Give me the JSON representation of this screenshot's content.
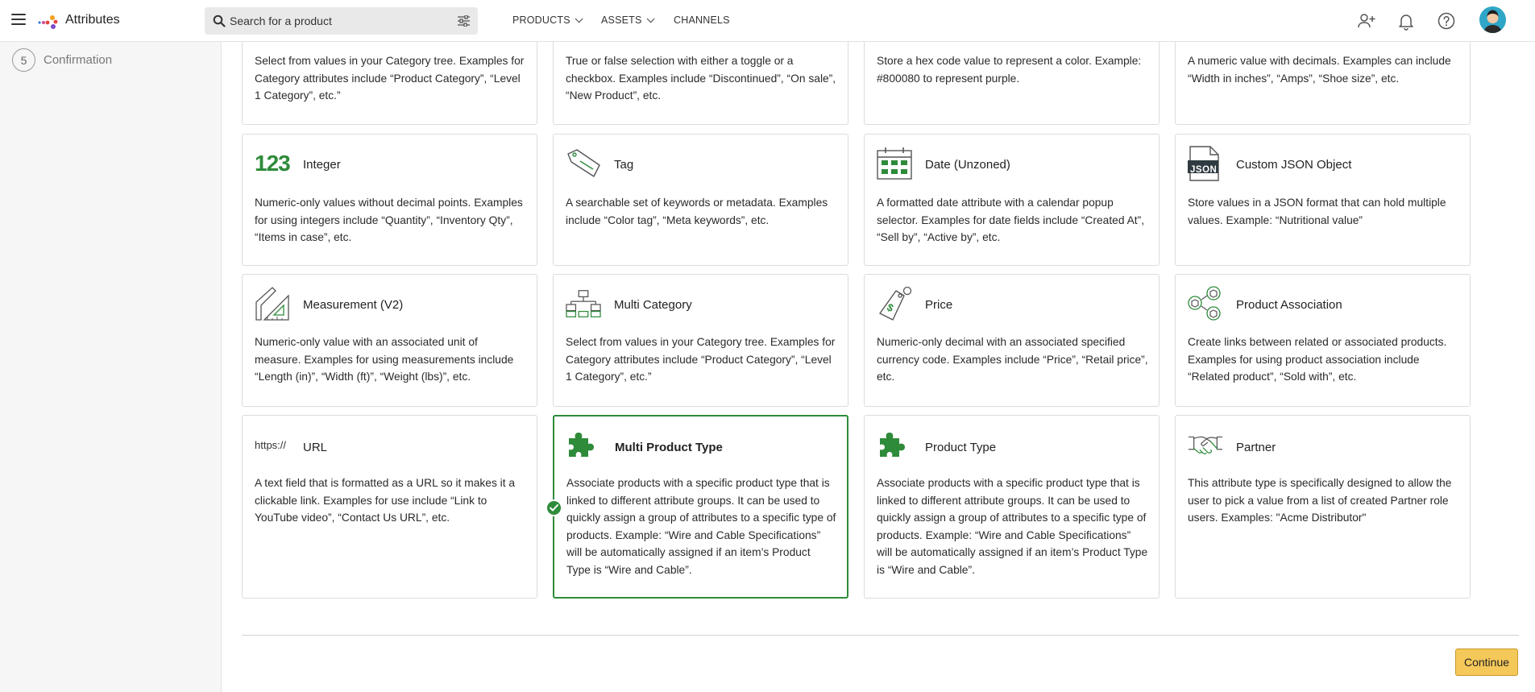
{
  "app": {
    "title": "Attributes"
  },
  "search": {
    "placeholder": "Search for a product"
  },
  "nav": [
    {
      "label": "PRODUCTS"
    },
    {
      "label": "ASSETS"
    },
    {
      "label": "CHANNELS"
    }
  ],
  "topbar_icons": [
    "add-user-icon",
    "bell-icon",
    "help-icon"
  ],
  "sidebar": {
    "step": {
      "number": "5",
      "label": "Confirmation"
    }
  },
  "cards_row1": [
    {
      "desc": "Select from values in your Category tree. Examples for Category attributes include “Product Category”, “Level 1 Category”, etc.”"
    },
    {
      "desc": "True or false selection with either a toggle or a checkbox. Examples include “Discontinued”, “On sale”, “New Product”, etc."
    },
    {
      "desc": "Store a hex code value to represent a color. Example: #800080 to represent purple."
    },
    {
      "desc": "A numeric value with decimals. Examples can include “Width in inches”, “Amps”, “Shoe size”, etc."
    }
  ],
  "cards_row2": [
    {
      "icon": "integer-123-icon",
      "icon_text": "123",
      "title": "Integer",
      "desc": "Numeric-only values without decimal points. Examples for using integers include “Quantity”, “Inventory Qty”, “Items in case”, etc."
    },
    {
      "icon": "tag-icon",
      "title": "Tag",
      "desc": "A searchable set of keywords or metadata. Examples include “Color tag”, “Meta keywords”, etc."
    },
    {
      "icon": "calendar-icon",
      "title": "Date (Unzoned)",
      "desc": "A formatted date attribute with a calendar popup selector. Examples for date fields include “Created At”, “Sell by”, “Active by”, etc."
    },
    {
      "icon": "json-file-icon",
      "icon_text": "JSON",
      "title": "Custom JSON Object",
      "desc": "Store values in a JSON format that can hold multiple values. Example: “Nutritional value”"
    }
  ],
  "cards_row3": [
    {
      "icon": "measurement-ruler-icon",
      "title": "Measurement (V2)",
      "desc": "Numeric-only value with an associated unit of measure. Examples for using measurements include “Length (in)”, “Width (ft)”, “Weight (lbs)”, etc."
    },
    {
      "icon": "hierarchy-tree-icon",
      "title": "Multi Category",
      "desc": "Select from values in your Category tree. Examples for Category attributes include “Product Category”, “Level 1 Category”, etc.”"
    },
    {
      "icon": "price-tag-icon",
      "title": "Price",
      "desc": "Numeric-only decimal with an associated specified currency code. Examples include “Price”, “Retail price”, etc."
    },
    {
      "icon": "product-association-icon",
      "title": "Product Association",
      "desc": "Create links between related or associated products. Examples for using product association include “Related product”, “Sold with”, etc."
    }
  ],
  "cards_row4": [
    {
      "icon": "url-icon",
      "icon_text": "https://",
      "title": "URL",
      "desc": "A text field that is formatted as a URL so it makes it a clickable link. Examples for use include “Link to YouTube video”, “Contact Us URL”, etc."
    },
    {
      "icon": "puzzle-piece-icon",
      "title": "Multi Product Type",
      "selected": true,
      "desc": "Associate products with a specific product type that is linked to different attribute groups. It can be used to quickly assign a group of attributes to a specific type of products. Example: “Wire and Cable Specifications” will be automatically assigned if an item’s Product Type is “Wire and Cable”."
    },
    {
      "icon": "puzzle-piece-icon",
      "title": "Product Type",
      "desc": "Associate products with a specific product type that is linked to different attribute groups. It can be used to quickly assign a group of attributes to a specific type of products. Example: “Wire and Cable Specifications” will be automatically assigned if an item’s Product Type is “Wire and Cable”."
    },
    {
      "icon": "handshake-icon",
      "title": "Partner",
      "desc": "This attribute type is specifically designed to allow the user to pick a value from a list of created Partner role users. Examples: \"Acme Distributor\""
    }
  ],
  "footer": {
    "continue_label": "Continue"
  },
  "colors": {
    "accent_green": "#2e8b3a",
    "continue_bg": "#f5c85a"
  }
}
